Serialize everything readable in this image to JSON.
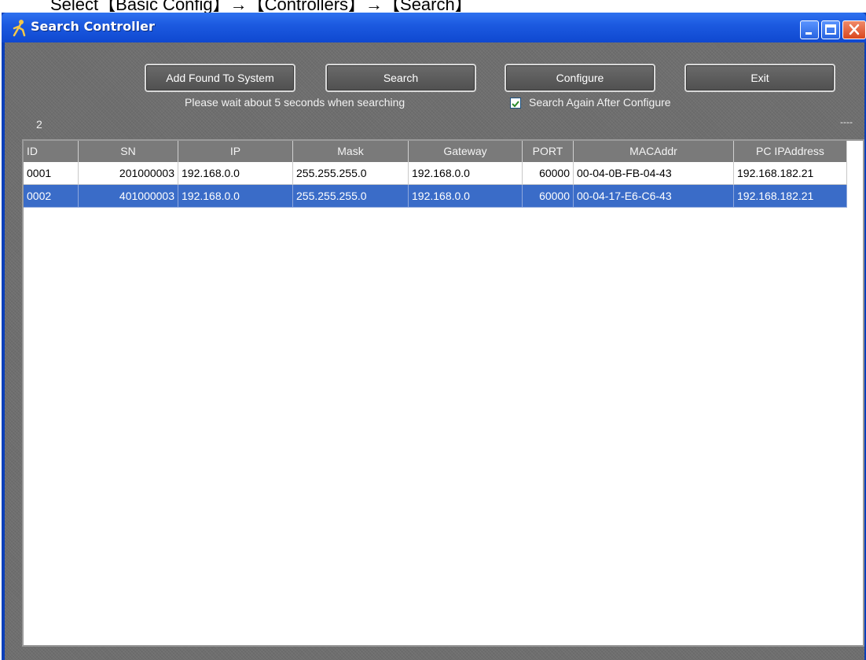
{
  "caption": "Select【Basic Config】→【Controllers】→【Search】",
  "window": {
    "title": "Search Controller"
  },
  "toolbar": {
    "add_found_label": "Add Found To System",
    "search_label": "Search",
    "configure_label": "Configure",
    "exit_label": "Exit",
    "hint": "Please wait about 5 seconds when searching",
    "search_again_label": "Search Again After Configure",
    "search_again_checked": true
  },
  "status": {
    "count": "2",
    "dots": "----"
  },
  "table": {
    "columns": [
      "ID",
      "SN",
      "IP",
      "Mask",
      "Gateway",
      "PORT",
      "MACAddr",
      "PC IPAddress"
    ],
    "rows": [
      {
        "id": "0001",
        "sn": "201000003",
        "ip": "192.168.0.0",
        "mask": "255.255.255.0",
        "gateway": "192.168.0.0",
        "port": "60000",
        "mac": "00-04-0B-FB-04-43",
        "pcip": "192.168.182.21",
        "selected": false
      },
      {
        "id": "0002",
        "sn": "401000003",
        "ip": "192.168.0.0",
        "mask": "255.255.255.0",
        "gateway": "192.168.0.0",
        "port": "60000",
        "mac": "00-04-17-E6-C6-43",
        "pcip": "192.168.182.21",
        "selected": true
      }
    ]
  },
  "colors": {
    "titlebar": "#1c5ae0",
    "selection": "#3a6cc8",
    "client_bg": "#6e6e6e"
  }
}
